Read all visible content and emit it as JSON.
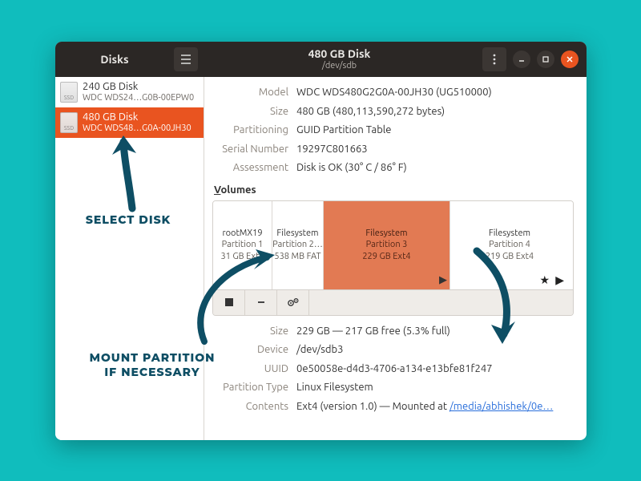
{
  "header": {
    "left_title": "Disks",
    "center_title": "480 GB Disk",
    "center_subtitle": "/dev/sdb"
  },
  "sidebar": {
    "disks": [
      {
        "title": "240 GB Disk",
        "model": "WDC WDS24…G0B-00EPW0"
      },
      {
        "title": "480 GB Disk",
        "model": "WDC WDS48…G0A-00JH30"
      }
    ]
  },
  "disk_info": {
    "model_k": "Model",
    "model_v": "WDC WDS480G2G0A-00JH30 (UG510000)",
    "size_k": "Size",
    "size_v": "480 GB (480,113,590,272 bytes)",
    "part_k": "Partitioning",
    "part_v": "GUID Partition Table",
    "serial_k": "Serial Number",
    "serial_v": "19297C801663",
    "assess_k": "Assessment",
    "assess_v": "Disk is OK (30° C / 86° F)"
  },
  "volumes_label": {
    "first": "V",
    "rest": "olumes"
  },
  "volumes": [
    {
      "name": "rootMX19",
      "part": "Partition 1",
      "fs": "31 GB Ext4",
      "width": 74
    },
    {
      "name": "Filesystem",
      "part": "Partition 2…",
      "fs": "538 MB FAT",
      "width": 64
    },
    {
      "name": "Filesystem",
      "part": "Partition 3",
      "fs": "229 GB Ext4",
      "width": 158,
      "selected": true
    },
    {
      "name": "Filesystem",
      "part": "Partition 4",
      "fs": "219 GB Ext4",
      "width": 148
    }
  ],
  "partition_info": {
    "size_k": "Size",
    "size_v": "229 GB — 217 GB free (5.3% full)",
    "dev_k": "Device",
    "dev_v": "/dev/sdb3",
    "uuid_k": "UUID",
    "uuid_v": "0e50058e-d4d3-4706-a134-e13bfe81f247",
    "pt_k": "Partition Type",
    "pt_v": "Linux Filesystem",
    "cont_k": "Contents",
    "cont_prefix": "Ext4 (version 1.0) — Mounted at ",
    "cont_link": "/media/abhishek/0e…"
  },
  "annotations": {
    "select_disk": "SELECT DISK",
    "mount": "MOUNT PARTITION\nIF NECESSARY"
  }
}
